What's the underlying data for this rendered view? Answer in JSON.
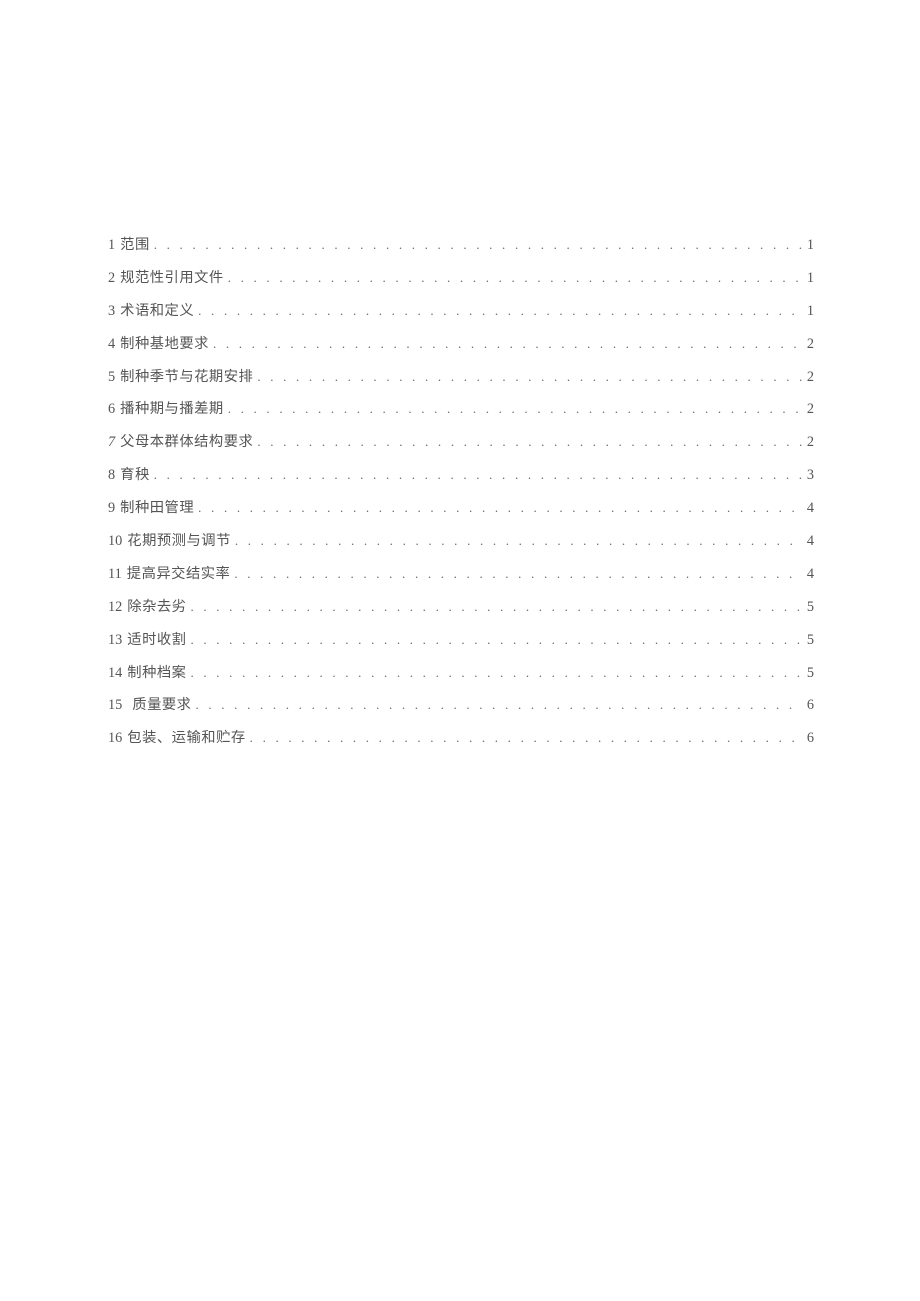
{
  "toc": {
    "entries": [
      {
        "num": "1",
        "label": "范围",
        "page": "1",
        "italic": false,
        "wideGap": false
      },
      {
        "num": "2",
        "label": "规范性引用文件",
        "page": "1",
        "italic": false,
        "wideGap": false
      },
      {
        "num": "3",
        "label": "术语和定义",
        "page": "1",
        "italic": false,
        "wideGap": false
      },
      {
        "num": "4",
        "label": "制种基地要求",
        "page": "2",
        "italic": false,
        "wideGap": false
      },
      {
        "num": "5",
        "label": "制种季节与花期安排",
        "page": "2",
        "italic": false,
        "wideGap": false
      },
      {
        "num": "6",
        "label": "播种期与播差期",
        "page": "2",
        "italic": false,
        "wideGap": false
      },
      {
        "num": "7",
        "label": "父母本群体结构要求",
        "page": "2",
        "italic": true,
        "wideGap": false
      },
      {
        "num": "8",
        "label": "育秧",
        "page": "3",
        "italic": false,
        "wideGap": false
      },
      {
        "num": "9",
        "label": "制种田管理",
        "page": "4",
        "italic": false,
        "wideGap": false
      },
      {
        "num": "10",
        "label": "花期预测与调节",
        "page": "4",
        "italic": false,
        "wideGap": false
      },
      {
        "num": "11",
        "label": "提高异交结实率",
        "page": "4",
        "italic": false,
        "wideGap": false
      },
      {
        "num": "12",
        "label": "除杂去劣",
        "page": "5",
        "italic": false,
        "wideGap": false
      },
      {
        "num": "13",
        "label": "适时收割",
        "page": "5",
        "italic": false,
        "wideGap": false
      },
      {
        "num": "14",
        "label": "制种档案",
        "page": "5",
        "italic": false,
        "wideGap": false
      },
      {
        "num": "15",
        "label": "质量要求",
        "page": "6",
        "italic": false,
        "wideGap": true
      },
      {
        "num": "16",
        "label": "包装、运输和贮存",
        "page": "6",
        "italic": false,
        "wideGap": false
      }
    ]
  }
}
